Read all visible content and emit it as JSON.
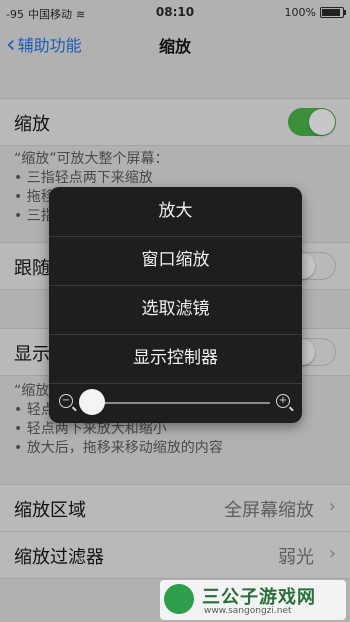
{
  "status": {
    "signal": "-95",
    "carrier": "中国移动",
    "time": "08:10",
    "battery": "100%",
    "battery_level": 1.0
  },
  "nav": {
    "back_label": "辅助功能",
    "title": "缩放"
  },
  "zoom_row": {
    "label": "缩放",
    "enabled": true
  },
  "zoom_desc": [
    "“缩放”可放大整个屏幕：",
    "• 三指轻点两下来缩放",
    "• 拖移",
    "• 三指"
  ],
  "follow_row": {
    "label": "跟随"
  },
  "controller_row": {
    "label": "显示"
  },
  "controller_desc": [
    "“缩放",
    "• 轻点",
    "• 轻点两下来放大和缩小",
    "• 放大后，拖移来移动缩放的内容"
  ],
  "zoom_region": {
    "label": "缩放区域",
    "value": "全屏幕缩放"
  },
  "zoom_filter": {
    "label": "缩放过滤器",
    "value": "弱光"
  },
  "popup": {
    "items": [
      "放大",
      "窗口缩放",
      "选取滤镜",
      "显示控制器"
    ],
    "slider_level": 0.0
  },
  "watermark": {
    "title": "三公子游戏网",
    "url": "www.sangongzi.net"
  }
}
